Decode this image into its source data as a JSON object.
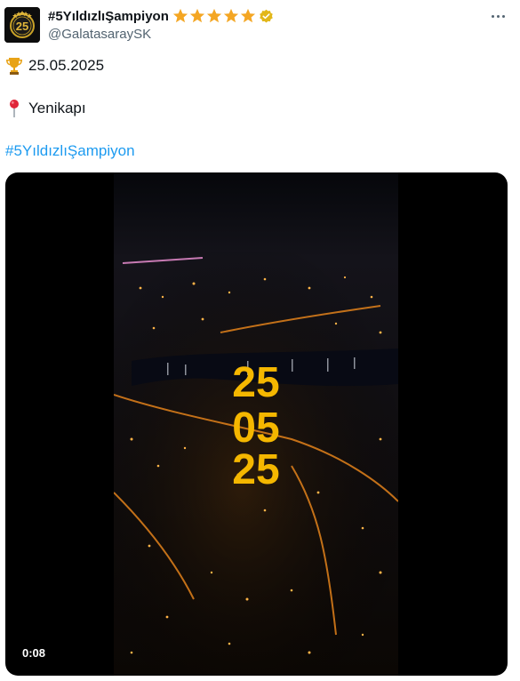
{
  "author": {
    "display_name": "#5YıldızlıŞampiyon",
    "handle": "@GalatasaraySK",
    "avatar_text": "25",
    "star_count": 5,
    "verified": true
  },
  "tweet": {
    "line1_icon": "trophy-icon",
    "line1_text": "25.05.2025",
    "line2_icon": "pin-icon",
    "line2_text": "Yenikapı",
    "hashtag": "#5YıldızlıŞampiyon"
  },
  "media": {
    "overlay_lines": [
      "25",
      "05",
      "25"
    ],
    "timestamp": "0:08"
  },
  "colors": {
    "accent": "#1d9bf0",
    "star": "#f4a623",
    "verified_gold": "#e2b719",
    "overlay_yellow": "#f5b700"
  }
}
